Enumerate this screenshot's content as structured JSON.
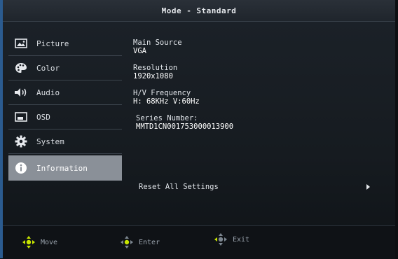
{
  "header": {
    "title": "Mode - Standard"
  },
  "sidebar": {
    "items": [
      {
        "label": "Picture",
        "icon": "picture-icon"
      },
      {
        "label": "Color",
        "icon": "palette-icon"
      },
      {
        "label": "Audio",
        "icon": "speaker-icon"
      },
      {
        "label": "OSD",
        "icon": "osd-icon"
      },
      {
        "label": "System",
        "icon": "gear-icon"
      },
      {
        "label": "Information",
        "icon": "info-icon",
        "active": true
      }
    ]
  },
  "info": {
    "main_source_label": "Main Source",
    "main_source_value": "VGA",
    "resolution_label": "Resolution",
    "resolution_value": "1920x1080",
    "frequency_label": "H/V Frequency",
    "frequency_value": "H: 68KHz V:60Hz",
    "series_label": "Series Number:",
    "series_value": "MMTD1CN001753000013900"
  },
  "reset": {
    "label": "Reset All Settings"
  },
  "footer": {
    "move_label": "Move",
    "enter_label": "Enter",
    "exit_label": "Exit"
  },
  "colors": {
    "active_bg": "#8a9098",
    "accent_green": "#c8e600"
  }
}
